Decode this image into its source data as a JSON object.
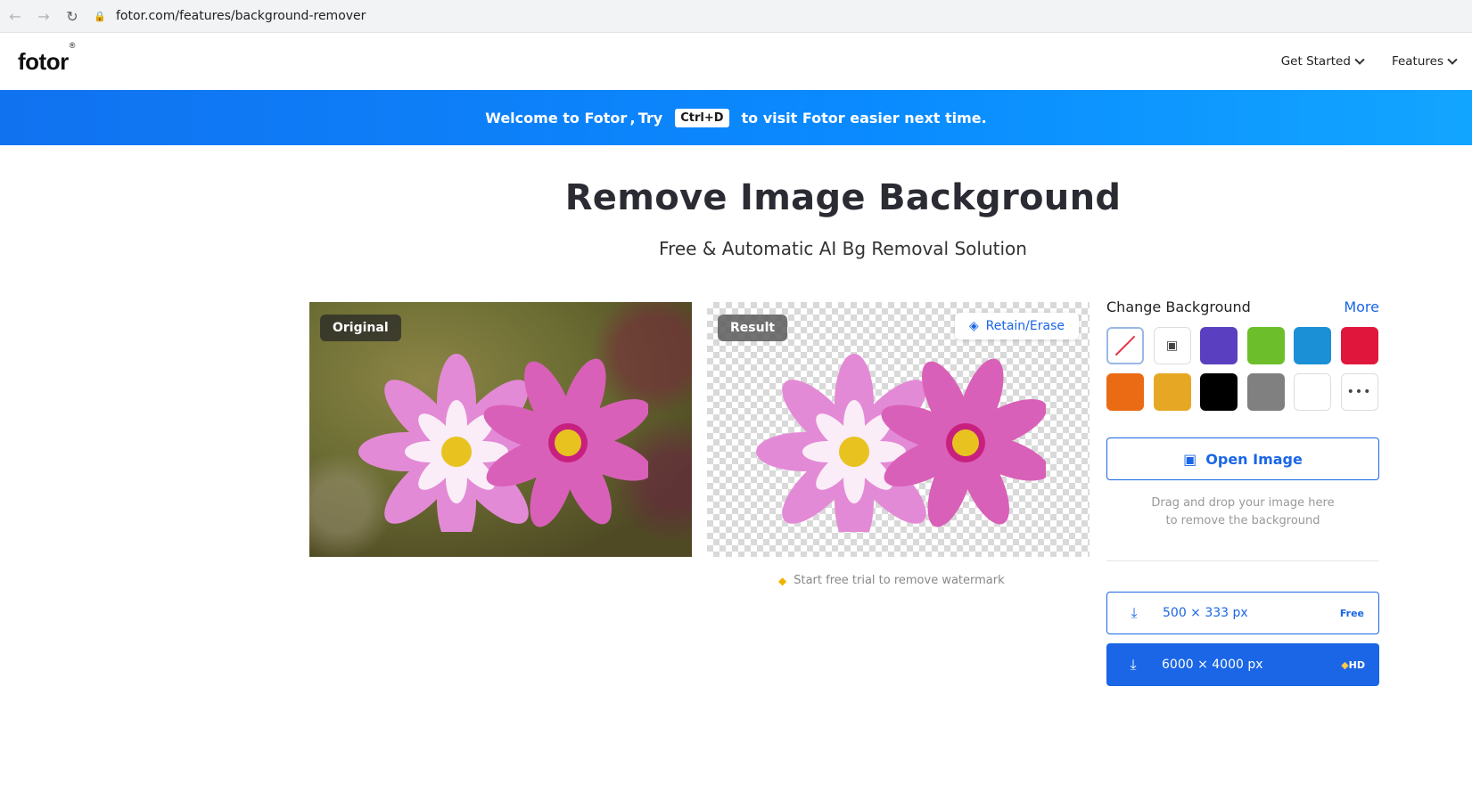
{
  "browser": {
    "url": "fotor.com/features/background-remover"
  },
  "header": {
    "logo": "fotor",
    "logo_mark": "®",
    "nav": [
      {
        "label": "Get Started"
      },
      {
        "label": "Features"
      }
    ]
  },
  "banner": {
    "prefix": "Welcome to Fotor , Try",
    "shortcut": "Ctrl+D",
    "suffix": "to visit Fotor easier next time."
  },
  "hero": {
    "title": "Remove Image Background",
    "subtitle": "Free & Automatic AI Bg Removal Solution"
  },
  "preview": {
    "original_label": "Original",
    "result_label": "Result",
    "retain_erase_label": "Retain/Erase",
    "watermark_note": "Start free trial to remove watermark"
  },
  "side": {
    "title": "Change Background",
    "more_label": "More",
    "swatches": [
      "none",
      "image",
      "#5a3fc0",
      "#6cbf2a",
      "#1b90d6",
      "#e0163c",
      "#ea6b14",
      "#e6a824",
      "#000000",
      "#808080",
      "#ffffff",
      "more"
    ],
    "open_image_label": "Open Image",
    "drop_line1": "Drag and drop your image here",
    "drop_line2": "to remove the background",
    "downloads": [
      {
        "size": "500 × 333 px",
        "tag": "Free"
      },
      {
        "size": "6000 × 4000 px",
        "tag": "HD"
      }
    ]
  },
  "colors": {
    "accent": "#1a66e6",
    "banner": "#0a8bff"
  }
}
